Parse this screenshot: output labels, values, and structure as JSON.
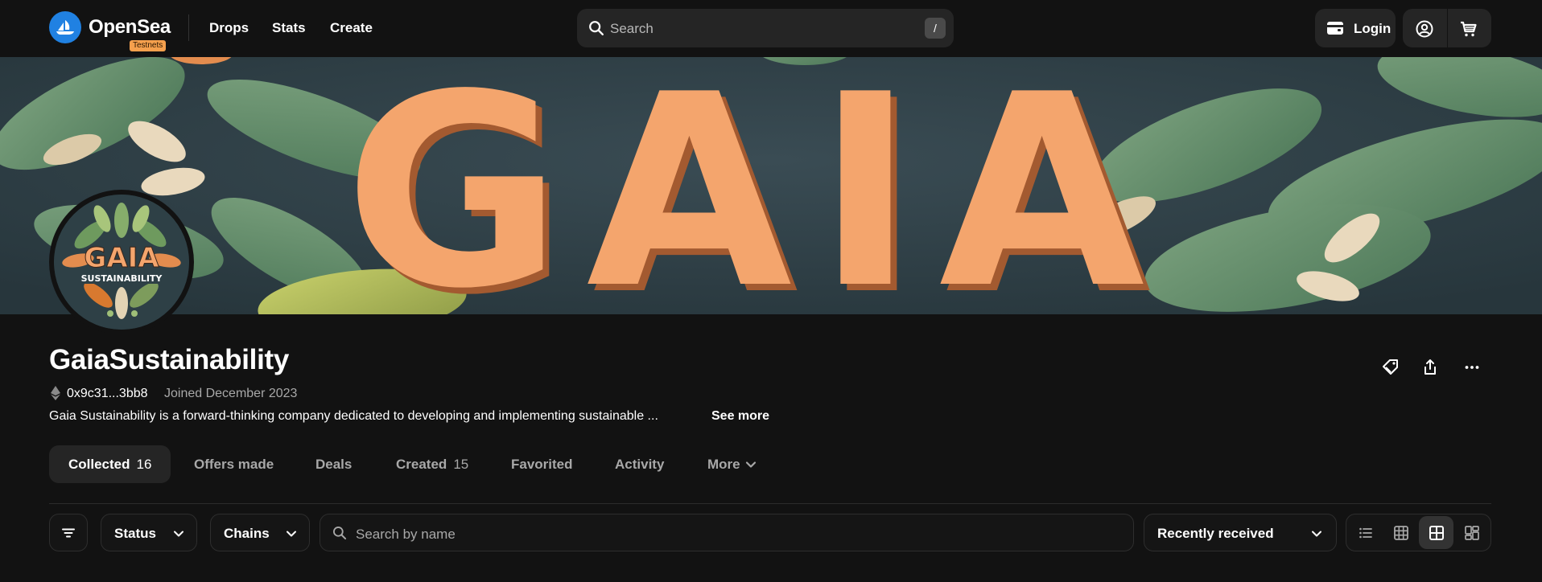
{
  "brand": {
    "name": "OpenSea",
    "badge": "Testnets"
  },
  "nav": {
    "drops": "Drops",
    "stats": "Stats",
    "create": "Create"
  },
  "search": {
    "placeholder": "Search",
    "shortcut": "/"
  },
  "auth": {
    "login": "Login"
  },
  "banner": {
    "text": "GAIA"
  },
  "avatar": {
    "title": "GAIA",
    "subtitle": "SUSTAINABILITY"
  },
  "profile": {
    "name": "GaiaSustainability",
    "address": "0x9c31...3bb8",
    "joined": "Joined December 2023",
    "description": "Gaia Sustainability is a forward-thinking company dedicated to developing and implementing sustainable ...",
    "see_more": "See more"
  },
  "tabs": [
    {
      "label": "Collected",
      "count": "16"
    },
    {
      "label": "Offers made"
    },
    {
      "label": "Deals"
    },
    {
      "label": "Created",
      "count": "15"
    },
    {
      "label": "Favorited"
    },
    {
      "label": "Activity"
    },
    {
      "label": "More"
    }
  ],
  "filters": {
    "status": "Status",
    "chains": "Chains",
    "search_placeholder": "Search by name",
    "sort": "Recently received"
  },
  "colors": {
    "background": "#121212",
    "surface": "#252525",
    "accent": "#2081e2",
    "testnet_badge": "#f5a04d",
    "banner_letters": "#f4a56d"
  }
}
